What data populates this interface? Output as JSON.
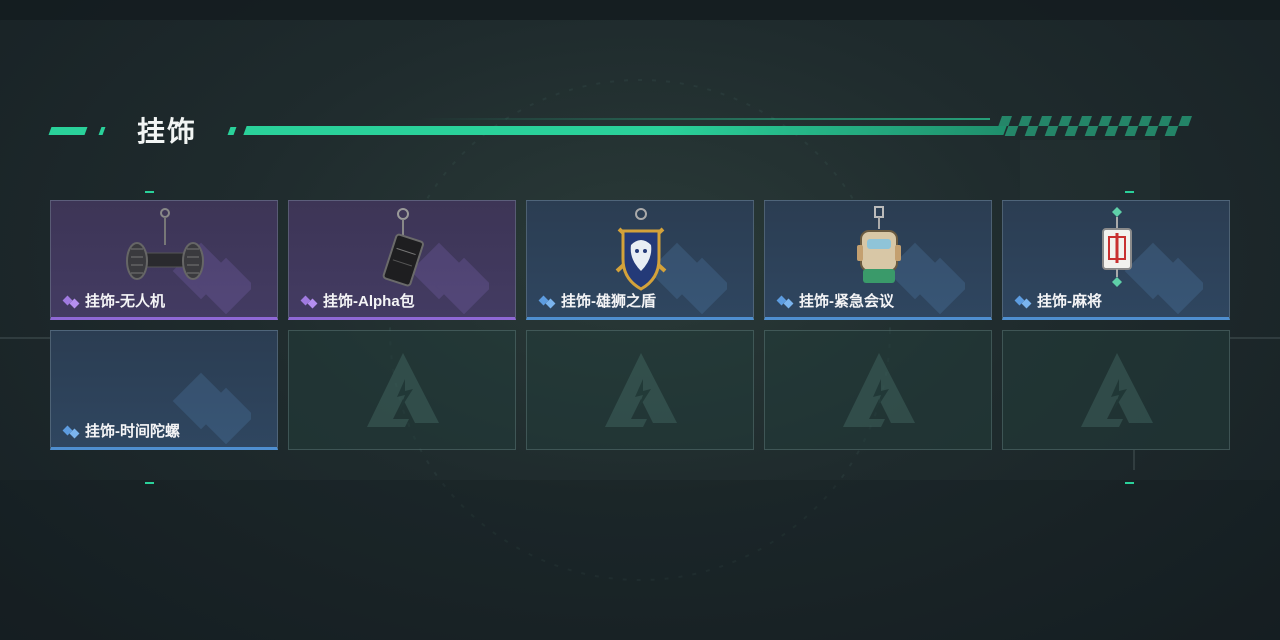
{
  "section": {
    "title": "挂饰"
  },
  "colors": {
    "accent": "#2ad19a",
    "rarity_purple": "#8f68d6",
    "rarity_blue": "#4f8fd0",
    "empty_slot": "#22403c"
  },
  "items": [
    {
      "label": "挂饰-无人机",
      "rarity": "purple",
      "icon": "drone-charm-icon"
    },
    {
      "label": "挂饰-Alpha包",
      "rarity": "purple",
      "icon": "alpha-bag-charm-icon"
    },
    {
      "label": "挂饰-雄狮之盾",
      "rarity": "blue",
      "icon": "lion-shield-charm-icon"
    },
    {
      "label": "挂饰-紧急会议",
      "rarity": "blue",
      "icon": "emergency-meeting-charm-icon"
    },
    {
      "label": "挂饰-麻将",
      "rarity": "blue",
      "icon": "mahjong-charm-icon"
    },
    {
      "label": "挂饰-时间陀螺",
      "rarity": "blue",
      "icon": "time-top-charm-icon"
    }
  ],
  "empty_slots": 4
}
